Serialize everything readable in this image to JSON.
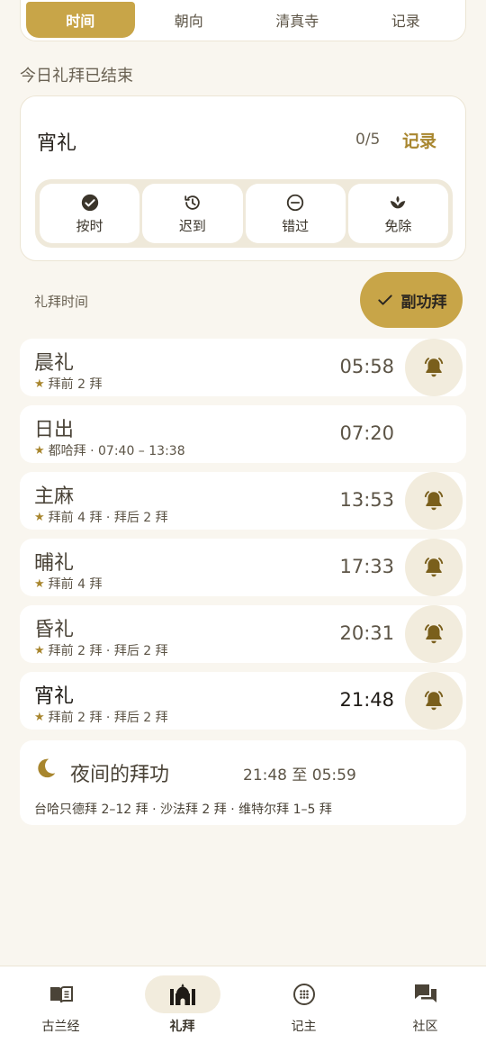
{
  "top_tabs": [
    {
      "label": "时间",
      "active": true
    },
    {
      "label": "朝向",
      "active": false
    },
    {
      "label": "清真寺",
      "active": false
    },
    {
      "label": "记录",
      "active": false
    }
  ],
  "status_title": "今日礼拜已结束",
  "summary": {
    "current_prayer": "宵礼",
    "count": "0/5",
    "record_label": "记录",
    "statuses": [
      {
        "label": "按时",
        "icon": "check-circle-icon"
      },
      {
        "label": "迟到",
        "icon": "history-icon"
      },
      {
        "label": "错过",
        "icon": "minus-circle-icon"
      },
      {
        "label": "免除",
        "icon": "lotus-icon"
      }
    ]
  },
  "times_label": "礼拜时间",
  "voluntary_label": "副功拜",
  "prayers": [
    {
      "name": "晨礼",
      "sub": "拜前 2 拜",
      "time": "05:58",
      "bell": true,
      "current": false
    },
    {
      "name": "日出",
      "sub": "都哈拜 · 07:40 – 13:38",
      "time": "07:20",
      "bell": false,
      "current": false
    },
    {
      "name": "主麻",
      "sub": "拜前 4 拜 · 拜后 2 拜",
      "time": "13:53",
      "bell": true,
      "current": false
    },
    {
      "name": "晡礼",
      "sub": "拜前 4 拜",
      "time": "17:33",
      "bell": true,
      "current": false
    },
    {
      "name": "昏礼",
      "sub": "拜前 2 拜 · 拜后 2 拜",
      "time": "20:31",
      "bell": true,
      "current": false
    },
    {
      "name": "宵礼",
      "sub": "拜前 2 拜 · 拜后 2 拜",
      "time": "21:48",
      "bell": true,
      "current": true
    }
  ],
  "night": {
    "title": "夜间的拜功",
    "range": "21:48 至 05:59",
    "desc": "台哈只德拜 2–12 拜 · 沙法拜 2 拜 · 维特尔拜 1–5 拜"
  },
  "bottom_nav": [
    {
      "label": "古兰经",
      "icon": "book-icon",
      "active": false
    },
    {
      "label": "礼拜",
      "icon": "mosque-icon",
      "active": true
    },
    {
      "label": "记主",
      "icon": "tasbih-icon",
      "active": false
    },
    {
      "label": "社区",
      "icon": "chat-icon",
      "active": false
    }
  ],
  "colors": {
    "accent": "#c8a548",
    "accent_dark": "#a8862e",
    "background": "#f9f6ef"
  }
}
